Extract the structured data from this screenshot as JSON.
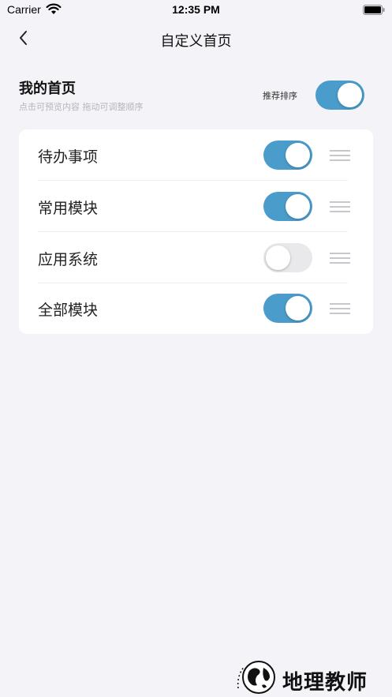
{
  "status_bar": {
    "carrier": "Carrier",
    "time": "12:35 PM"
  },
  "nav": {
    "title": "自定义首页"
  },
  "section": {
    "title": "我的首页",
    "hint": "点击可预览内容 拖动可调整顺序",
    "recommend_label": "推荐排序",
    "recommend_on": true
  },
  "modules": [
    {
      "label": "待办事项",
      "enabled": true
    },
    {
      "label": "常用模块",
      "enabled": true
    },
    {
      "label": "应用系统",
      "enabled": false
    },
    {
      "label": "全部模块",
      "enabled": true
    }
  ],
  "watermark": {
    "text": "地理教师"
  },
  "colors": {
    "accent": "#4a9ccb",
    "background": "#f4f4f8",
    "toggle_off": "#e9e9eb"
  }
}
